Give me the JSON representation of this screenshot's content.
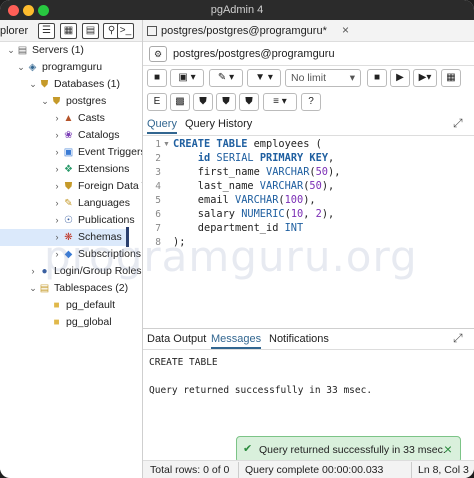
{
  "window": {
    "title": "pgAdmin 4"
  },
  "explorer": {
    "label": "plorer",
    "tree": [
      {
        "label": "Servers (1)",
        "icon": "servers-icon"
      },
      {
        "label": "programguru",
        "icon": "elephant-icon"
      },
      {
        "label": "Databases (1)",
        "icon": "databases-icon"
      },
      {
        "label": "postgres",
        "icon": "database-icon"
      },
      {
        "label": "Casts",
        "icon": "casts-icon"
      },
      {
        "label": "Catalogs",
        "icon": "catalogs-icon"
      },
      {
        "label": "Event Triggers",
        "icon": "event-triggers-icon"
      },
      {
        "label": "Extensions",
        "icon": "extensions-icon"
      },
      {
        "label": "Foreign Data W",
        "icon": "foreign-data-icon"
      },
      {
        "label": "Languages",
        "icon": "languages-icon"
      },
      {
        "label": "Publications",
        "icon": "publications-icon"
      },
      {
        "label": "Schemas",
        "icon": "schemas-icon"
      },
      {
        "label": "Subscriptions",
        "icon": "subscriptions-icon"
      },
      {
        "label": "Login/Group Roles",
        "icon": "roles-icon"
      },
      {
        "label": "Tablespaces (2)",
        "icon": "tablespaces-icon"
      },
      {
        "label": "pg_default",
        "icon": "folder-icon"
      },
      {
        "label": "pg_global",
        "icon": "folder-icon"
      }
    ]
  },
  "tab": {
    "title": "postgres/postgres@programguru*"
  },
  "connection": {
    "label": "postgres/postgres@programguru"
  },
  "toolbar": {
    "no_limit": "No limit"
  },
  "query_tabs": [
    {
      "label": "Query"
    },
    {
      "label": "Query History"
    }
  ],
  "editor": {
    "line_numbers": [
      "1",
      "2",
      "3",
      "4",
      "5",
      "6",
      "7",
      "8"
    ]
  },
  "output_tabs": [
    {
      "label": "Data Output"
    },
    {
      "label": "Messages"
    },
    {
      "label": "Notifications"
    }
  ],
  "messages": {
    "line1": "CREATE TABLE",
    "line2": "Query returned successfully in 33 msec."
  },
  "toast": {
    "text": "Query returned successfully in 33 msec."
  },
  "status": {
    "rows": "Total rows: 0 of 0",
    "complete": "Query complete 00:00:00.033",
    "position": "Ln 8, Col 3"
  },
  "watermark": "programguru.org",
  "colors": {
    "accent": "#326690",
    "keyword": "#1f5fa0",
    "number": "#7a2db5",
    "toast_bg": "#d9f0dc"
  }
}
